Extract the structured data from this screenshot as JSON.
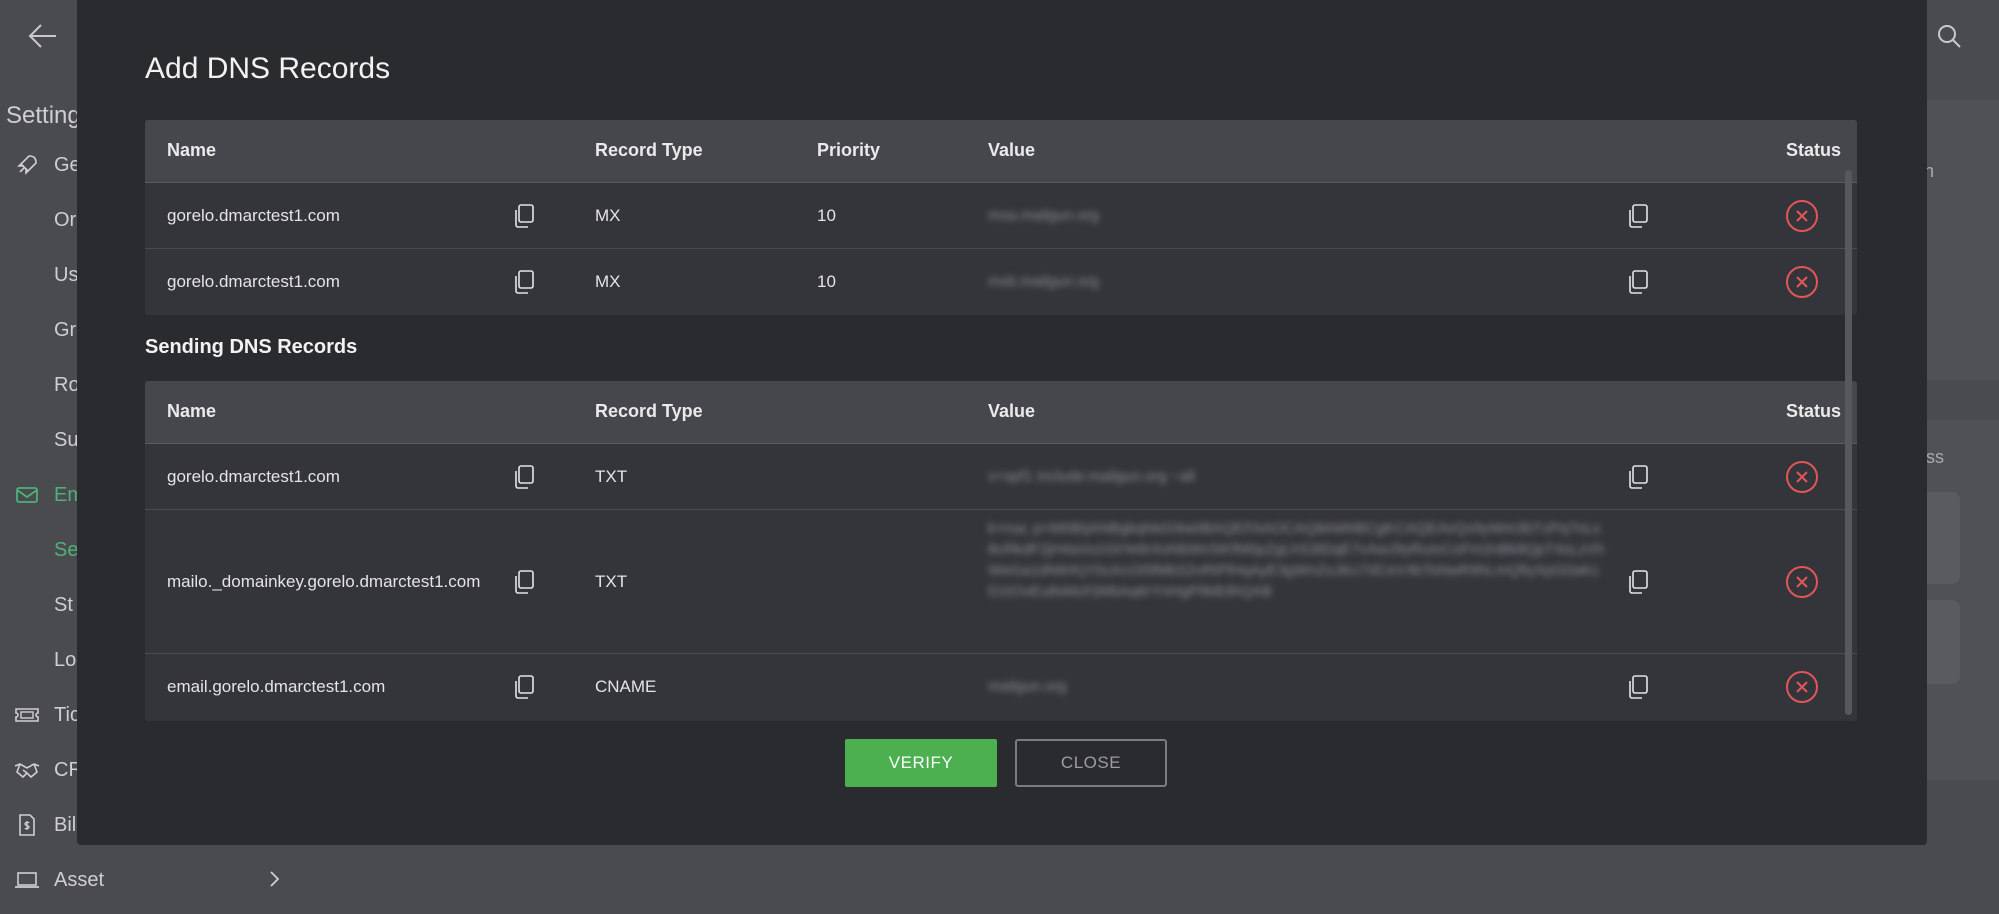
{
  "background": {
    "sidebar_heading": "Setting",
    "sidebar_items": [
      {
        "label": "Ge",
        "icon": "rocket-icon"
      },
      {
        "label": "Or",
        "icon": ""
      },
      {
        "label": "Us",
        "icon": ""
      },
      {
        "label": "Gr",
        "icon": ""
      },
      {
        "label": "Ro",
        "icon": ""
      },
      {
        "label": "Su",
        "icon": ""
      },
      {
        "label": "Em",
        "icon": "mail-icon"
      },
      {
        "label": "Se",
        "icon": ""
      },
      {
        "label": "St",
        "icon": ""
      },
      {
        "label": "Lo",
        "icon": ""
      },
      {
        "label": "Tic",
        "icon": "ticket-icon"
      },
      {
        "label": "CR",
        "icon": "handshake-icon"
      },
      {
        "label": "Bil",
        "icon": "billing-icon"
      },
      {
        "label": "Asset",
        "icon": "laptop-icon"
      }
    ],
    "right_text_1": "ain",
    "right_text_2": "ress",
    "accent_color": "#4fb07b"
  },
  "modal": {
    "title": "Add DNS Records",
    "receiving_table": {
      "headers": [
        "Name",
        "Record Type",
        "Priority",
        "Value",
        "Status"
      ],
      "rows": [
        {
          "name": "gorelo.dmarctest1.com",
          "type": "MX",
          "priority": "10",
          "value": "mxa.mailgun.org",
          "status": "error"
        },
        {
          "name": "gorelo.dmarctest1.com",
          "type": "MX",
          "priority": "10",
          "value": "mxb.mailgun.org",
          "status": "error"
        }
      ]
    },
    "sending_title": "Sending DNS Records",
    "sending_table": {
      "headers": [
        "Name",
        "Record Type",
        "Value",
        "Status"
      ],
      "rows": [
        {
          "name": "gorelo.dmarctest1.com",
          "type": "TXT",
          "value": "v=spf1 include:mailgun.org ~all",
          "status": "error"
        },
        {
          "name": "mailo._domainkey.gorelo.dmarctest1.com",
          "type": "TXT",
          "value": "k=rsa; p=MIIBIjANBgkqhkiG9w0BAQEFAAOCAQ8AMIIBCgKCAQEAvQx9yWm3bTzPq7nLs8cRkdF2jH4aVu1GtYe6rXoNbWc5iKfM0pZgLhS3tDqE7vAwJ9yRuIxCoFm2nBk8QpT4sLzVhWeGa1dN6rKjY0uXcOi5fMbS2vRtPlHqAyE3gWnZoJkU7dCeV4bTsNwR9hLmQfIyXpG0aKcD1tOvEu8sMzFjWbAq6rYnHgPlIkB3hQAB",
          "status": "error"
        },
        {
          "name": "email.gorelo.dmarctest1.com",
          "type": "CNAME",
          "value": "mailgun.org",
          "status": "error"
        }
      ]
    },
    "verify_label": "VERIFY",
    "close_label": "CLOSE",
    "error_color": "#e05757",
    "success_color": "#4caf50"
  }
}
